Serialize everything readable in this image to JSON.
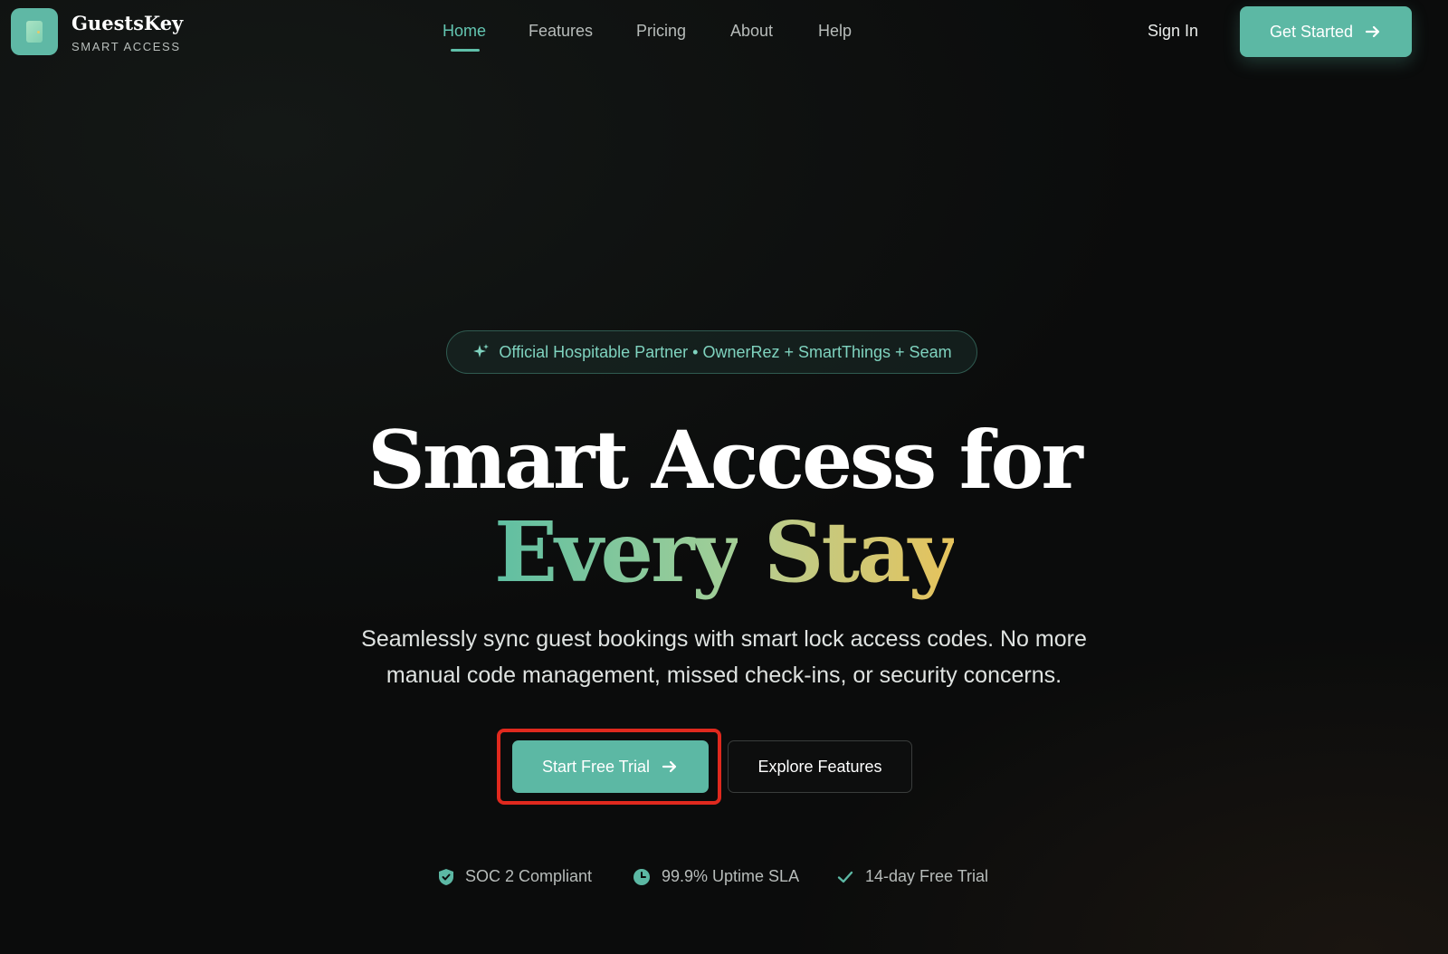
{
  "brand": {
    "name": "GuestsKey",
    "tagline": "SMART ACCESS",
    "logo_icon": "door-icon"
  },
  "nav": {
    "links": [
      {
        "label": "Home",
        "active": true
      },
      {
        "label": "Features",
        "active": false
      },
      {
        "label": "Pricing",
        "active": false
      },
      {
        "label": "About",
        "active": false
      },
      {
        "label": "Help",
        "active": false
      }
    ],
    "sign_in": "Sign In",
    "get_started": "Get Started"
  },
  "hero": {
    "badge": "Official Hospitable Partner • OwnerRez + SmartThings + Seam",
    "badge_icon": "sparkle-icon",
    "headline_line1": "Smart Access for",
    "headline_word1": "Every",
    "headline_word2": "Stay",
    "subtitle_line1": "Seamlessly sync guest bookings with smart lock access codes. No more",
    "subtitle_line2": "manual code management, missed check-ins, or security concerns.",
    "primary_cta": "Start Free Trial",
    "secondary_cta": "Explore Features"
  },
  "trust": [
    {
      "label": "SOC 2 Compliant",
      "icon": "shield-check-icon"
    },
    {
      "label": "99.9% Uptime SLA",
      "icon": "clock-icon"
    },
    {
      "label": "14-day Free Trial",
      "icon": "check-icon"
    }
  ],
  "colors": {
    "accent": "#5cb8a4",
    "accent_text": "#63c5b1",
    "gold": "#e6c35c",
    "background": "#0b0c0c",
    "highlight_border": "#e0291e"
  }
}
